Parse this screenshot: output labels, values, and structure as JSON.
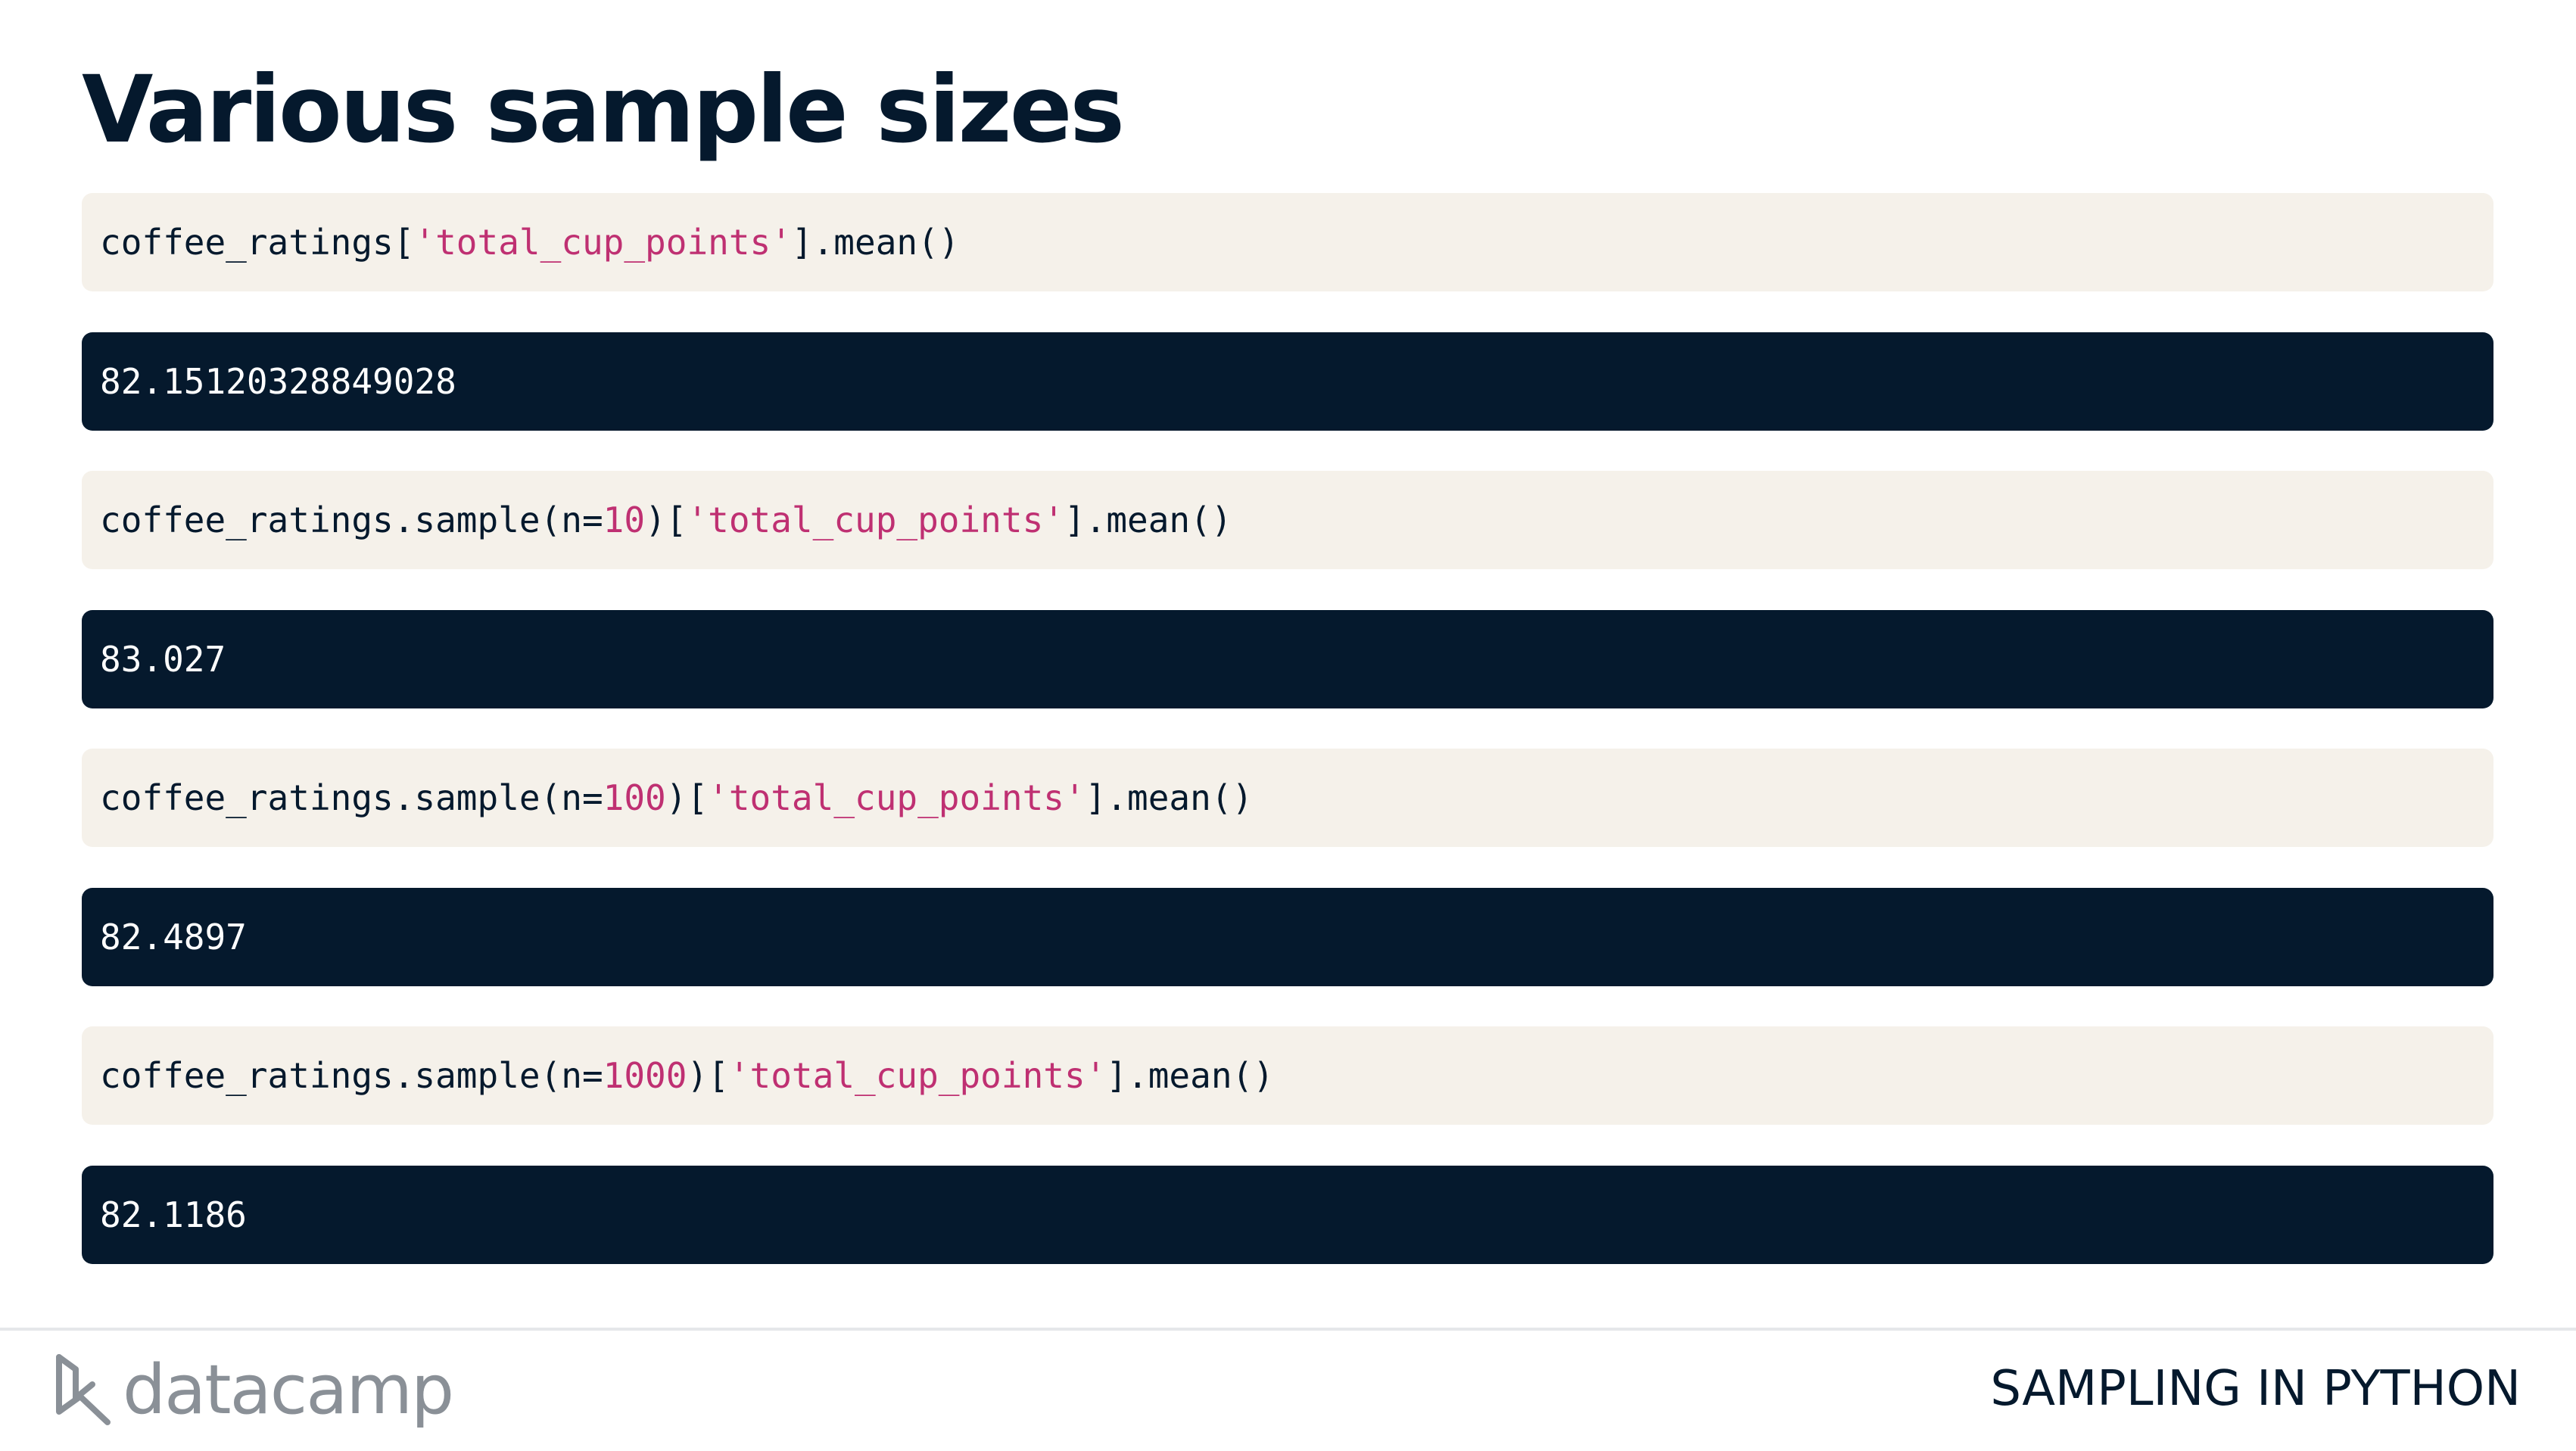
{
  "slide": {
    "title": "Various sample sizes"
  },
  "blocks": [
    {
      "kind": "code",
      "parts": [
        "coffee_ratings[",
        "'total_cup_points'",
        "].mean()"
      ]
    },
    {
      "kind": "output",
      "text": "82.15120328849028"
    },
    {
      "kind": "code",
      "parts": [
        "coffee_ratings.sample(n=",
        "10",
        ")[",
        "'total_cup_points'",
        "].mean()"
      ]
    },
    {
      "kind": "output",
      "text": "83.027"
    },
    {
      "kind": "code",
      "parts": [
        "coffee_ratings.sample(n=",
        "100",
        ")[",
        "'total_cup_points'",
        "].mean()"
      ]
    },
    {
      "kind": "output",
      "text": "82.4897"
    },
    {
      "kind": "code",
      "parts": [
        "coffee_ratings.sample(n=",
        "1000",
        ")[",
        "'total_cup_points'",
        "].mean()"
      ]
    },
    {
      "kind": "output",
      "text": "82.1186"
    }
  ],
  "footer": {
    "logo_text": "datacamp",
    "course_title": "SAMPLING IN PYTHON"
  },
  "colors": {
    "ink": "#05192d",
    "code_bg": "#f5f1ea",
    "output_bg": "#05192d",
    "string_literal": "#bf3072",
    "logo_gray": "#8a9097"
  },
  "icons": {
    "logo_mark": "datacamp-logo-icon"
  }
}
